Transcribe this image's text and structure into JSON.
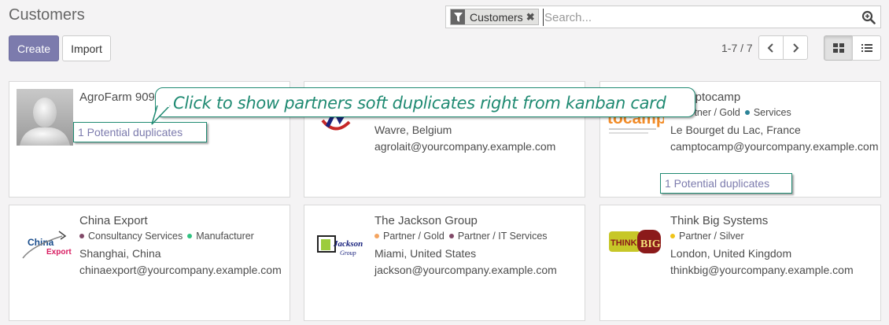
{
  "page": {
    "title": "Customers"
  },
  "search": {
    "facet_label": "Customers",
    "placeholder": "Search..."
  },
  "toolbar": {
    "create_label": "Create",
    "import_label": "Import"
  },
  "pager": {
    "value": "1-7 / 7"
  },
  "callout": {
    "text": "Click to show partners soft duplicates right from kanban card"
  },
  "colors": {
    "accent": "#7c7bad",
    "callout": "#1f8a72",
    "tag_gold": "#f4a460",
    "tag_services": "#2c8397",
    "tag_purple": "#814968",
    "tag_green": "#30c381",
    "tag_silver": "#f0c419"
  },
  "cards": [
    {
      "name": "AgroFarm 909",
      "duplicates": "1 Potential duplicates",
      "logo": "placeholder-avatar"
    },
    {
      "name": "",
      "location": "Wavre, Belgium",
      "email": "agrolait@yourcompany.example.com",
      "logo": "agrolait-logo"
    },
    {
      "name": "Camptocamp",
      "tags": [
        "Partner / Gold",
        "Services"
      ],
      "location": "Le Bourget du Lac, France",
      "email": "camptocamp@yourcompany.example.com",
      "duplicates": "1 Potential duplicates",
      "logo": "camptocamp-logo",
      "logo_text": "tocamp"
    },
    {
      "name": "China Export",
      "tags": [
        "Consultancy Services",
        "Manufacturer"
      ],
      "location": "Shanghai, China",
      "email": "chinaexport@yourcompany.example.com",
      "logo": "china-export-logo",
      "logo_text_1": "China",
      "logo_text_2": "Export"
    },
    {
      "name": "The Jackson Group",
      "tags": [
        "Partner / Gold",
        "Partner / IT Services"
      ],
      "location": "Miami, United States",
      "email": "jackson@yourcompany.example.com",
      "logo": "jackson-logo",
      "logo_text_1": "Jackson",
      "logo_text_2": "Group"
    },
    {
      "name": "Think Big Systems",
      "tags": [
        "Partner / Silver"
      ],
      "location": "London, United Kingdom",
      "email": "thinkbig@yourcompany.example.com",
      "logo": "think-big-logo",
      "logo_text_1": "THINK",
      "logo_text_2": "BIG"
    }
  ]
}
